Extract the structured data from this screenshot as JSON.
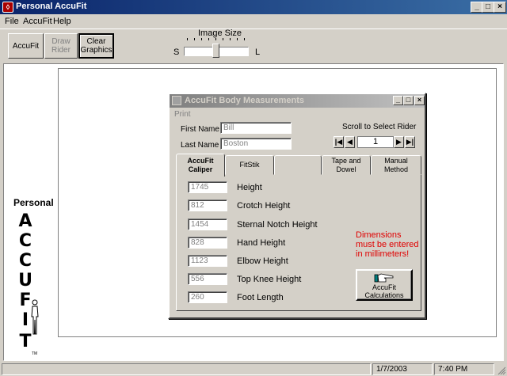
{
  "window": {
    "title": "Personal AccuFit",
    "icon": "app-logo-icon",
    "buttons": [
      "minimize-icon",
      "maximize-icon",
      "close-icon"
    ]
  },
  "menu": [
    "File",
    "AccuFit",
    "Help"
  ],
  "toolbar": {
    "accufit": "AccuFit",
    "draw_rider_1": "Draw",
    "draw_rider_2": "Rider",
    "clear_1": "Clear",
    "clear_2": "Graphics"
  },
  "image_size": {
    "label": "Image Size",
    "min_label": "S",
    "max_label": "L",
    "level_fraction": 0.5
  },
  "brand": {
    "personal": "Personal",
    "letters": [
      "A",
      "C",
      "C",
      "U",
      "F",
      "I",
      "T"
    ],
    "tm": "TM"
  },
  "dialog": {
    "title": "AccuFit Body Measurements",
    "menu": "Print",
    "first_name_label": "First Name",
    "first_name": "Bill",
    "last_name_label": "Last Name",
    "last_name": "Boston",
    "scroll_label": "Scroll to Select Rider",
    "rider_number": "1",
    "tabs": [
      {
        "label_1": "AccuFit",
        "label_2": "Caliper"
      },
      {
        "label_1": "FitStik",
        "label_2": ""
      },
      {
        "label_1": "",
        "label_2": ""
      },
      {
        "label_1": "Tape and",
        "label_2": "Dowel"
      },
      {
        "label_1": "Manual Method",
        "label_2": ""
      }
    ],
    "measurements": [
      {
        "value": "1745",
        "label": "Height"
      },
      {
        "value": "812",
        "label": "Crotch Height"
      },
      {
        "value": "1454",
        "label": "Sternal Notch Height"
      },
      {
        "value": "828",
        "label": "Hand Height"
      },
      {
        "value": "1123",
        "label": "Elbow Height"
      },
      {
        "value": "556",
        "label": "Top Knee Height"
      },
      {
        "value": "260",
        "label": "Foot Length"
      }
    ],
    "note_lines": [
      "Dimensions",
      "must be entered",
      "in millimeters!"
    ],
    "calc_1": "AccuFit",
    "calc_2": "Calculations",
    "note_color": "#e00000"
  },
  "status": {
    "date": "1/7/2003",
    "time": "7:40 PM"
  },
  "colors": {
    "titlebar": "#0a246a",
    "face": "#d4d0c8"
  }
}
